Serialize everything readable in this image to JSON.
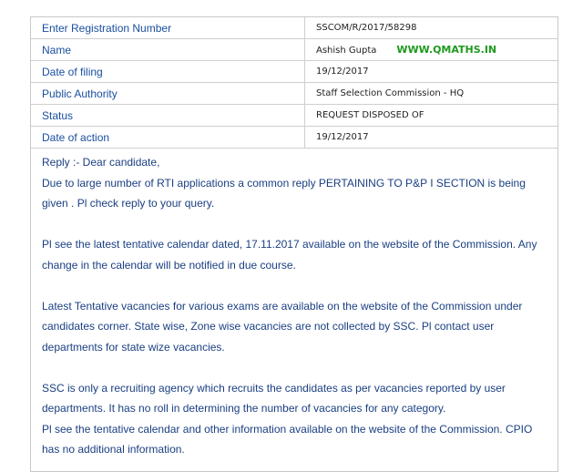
{
  "rows": [
    {
      "label": "Enter Registration Number",
      "value": "SSCOM/R/2017/58298"
    },
    {
      "label": "Name",
      "value": "Ashish Gupta"
    },
    {
      "label": "Date of filing",
      "value": "19/12/2017"
    },
    {
      "label": "Public Authority",
      "value": "Staff Selection Commission - HQ"
    },
    {
      "label": "Status",
      "value": "REQUEST DISPOSED OF"
    },
    {
      "label": "Date of action",
      "value": "19/12/2017"
    }
  ],
  "watermark": "WWW.QMATHS.IN",
  "reply": {
    "greeting": "Reply :- Dear candidate,",
    "p1": "Due to large number of RTI applications a common reply PERTAINING TO P&P I SECTION is being given . Pl check reply to your query.",
    "p2": "Pl see the latest tentative calendar dated, 17.11.2017 available on the website of the Commission. Any change in the calendar will be notified in due course.",
    "p3": "Latest Tentative vacancies for various exams are available on the website of the Commission under candidates corner. State wise, Zone wise vacancies are not collected by SSC. Pl contact user departments for state wize vacancies.",
    "p4": "SSC is only a recruiting agency which recruits the candidates as per vacancies reported by user departments. It has no roll in determining the number of vacancies for any category.",
    "p5": "Pl see the tentative calendar and other information available on the website of the Commission. CPIO has no additional information."
  },
  "colors": {
    "label": "#1a4fa0",
    "reply": "#1a3f82",
    "watermark": "#1e9a1e",
    "border": "#cfcfcf"
  }
}
